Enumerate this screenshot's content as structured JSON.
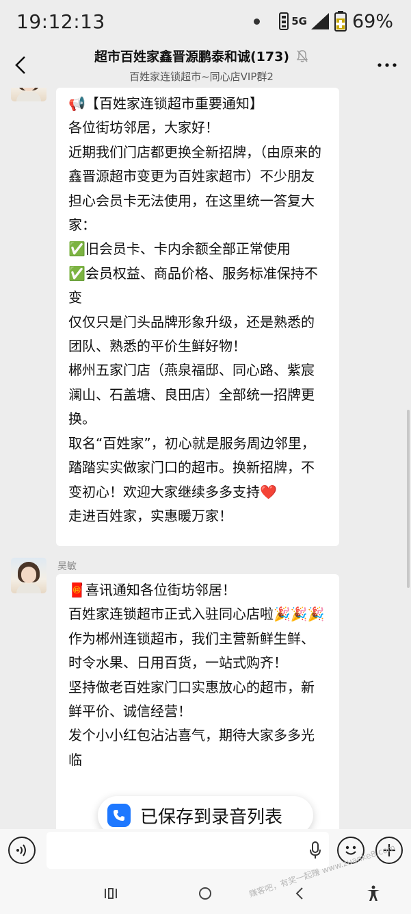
{
  "status_bar": {
    "time": "19:12:13",
    "network": "5G",
    "battery": "69%"
  },
  "header": {
    "title": "超市百姓家鑫晋源鹏泰和诚(173)",
    "subtitle": "百姓家连锁超市~同心店VIP群2"
  },
  "messages": [
    {
      "sender": "",
      "lines": [
        "📢【百姓家连锁超市重要通知】",
        "各位街坊邻居，大家好！",
        "近期我们门店都更换全新招牌，（由原来的鑫晋源超市变更为百姓家超市）不少朋友担心会员卡无法使用，在这里统一答复大家：",
        "✅旧会员卡、卡内余额全部正常使用",
        "✅会员权益、商品价格、服务标准保持不变",
        "仅仅只是门头品牌形象升级，还是熟悉的团队、熟悉的平价生鲜好物！",
        " 郴州五家门店（燕泉福邸、同心路、紫宸澜山、石盖塘、良田店）全部统一招牌更换。",
        "取名“百姓家”，初心就是服务周边邻里，踏踏实实做家门口的超市。换新招牌，不变初心！欢迎大家继续多多支持❤️",
        "走进百姓家，实惠暖万家！"
      ]
    },
    {
      "sender": "吴敏",
      "lines": [
        "🧧喜讯通知各位街坊邻居！",
        "百姓家连锁超市正式入驻同心店啦🎉🎉🎉",
        "作为郴州连锁超市，我们主营新鲜生鲜、时令水果、日用百货，一站式购齐！",
        "坚持做老百姓家门口实惠放心的超市，新鲜平价、诚信经营！",
        "发个小小红包沾沾喜气，期待大家多多光临"
      ]
    }
  ],
  "toast": {
    "text": "已保存到录音列表"
  },
  "watermark": "赚客吧，有奖一起赚 www.zuanke8.com",
  "icons": {
    "back": "back-arrow-icon",
    "mute": "mute-bell-icon",
    "more": "more-dots-icon",
    "voice": "voice-input-icon",
    "mic": "microphone-icon",
    "emoji": "emoji-icon",
    "plus": "plus-icon",
    "toast": "phone-icon"
  },
  "colors": {
    "background": "#ededed",
    "bubble": "#ffffff",
    "toast_icon": "#1e78ff"
  }
}
